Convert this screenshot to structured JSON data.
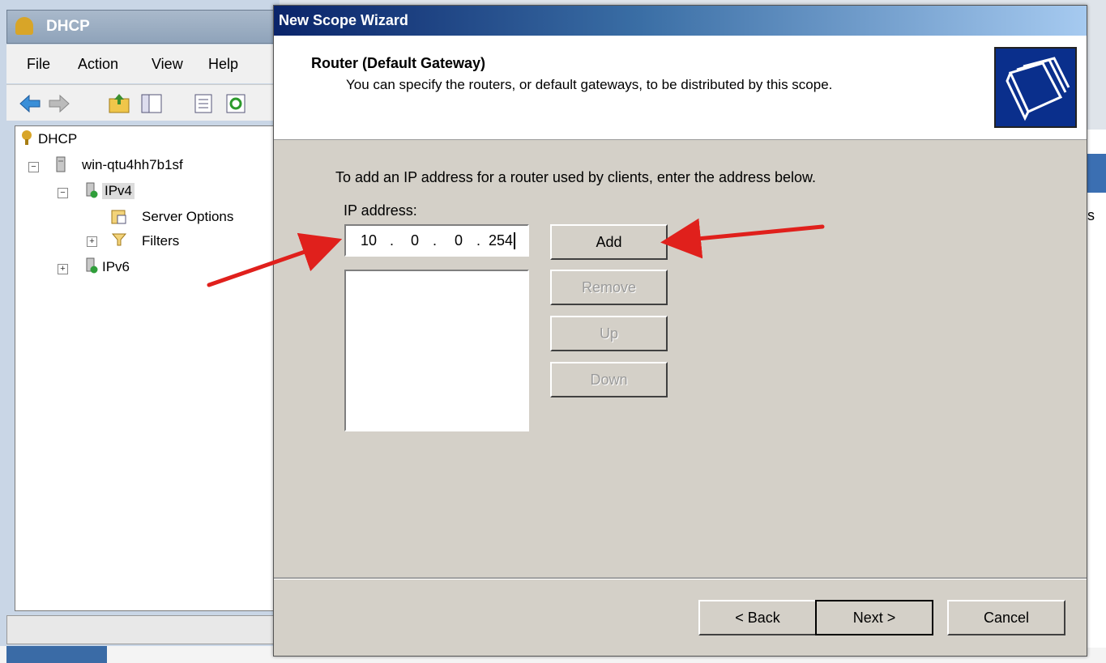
{
  "dhcp_window": {
    "title": "DHCP",
    "menu": [
      "File",
      "Action",
      "View",
      "Help"
    ],
    "tree": {
      "root": "DHCP",
      "server": "win-qtu4hh7b1sf",
      "ipv4": "IPv4",
      "server_options": "Server Options",
      "filters": "Filters",
      "ipv6": "IPv6"
    },
    "right_edge_char": "s"
  },
  "wizard": {
    "window_title": "New Scope Wizard",
    "header_title": "Router (Default Gateway)",
    "header_subtitle": "You can specify the routers, or default gateways, to be distributed by this scope.",
    "instruction": "To add an IP address for a router used by clients, enter the address below.",
    "ip_label": "IP address:",
    "ip_octets": [
      "10",
      "0",
      "0",
      "254"
    ],
    "ip_separator": ".",
    "buttons": {
      "add": "Add",
      "remove": "Remove",
      "up": "Up",
      "down": "Down"
    },
    "footer": {
      "back": "< Back",
      "next": "Next >",
      "cancel": "Cancel"
    }
  },
  "colors": {
    "annotation_arrow": "#e0201c",
    "wizard_title_bar": "#0a246a",
    "dialog_face": "#d4d0c8"
  }
}
